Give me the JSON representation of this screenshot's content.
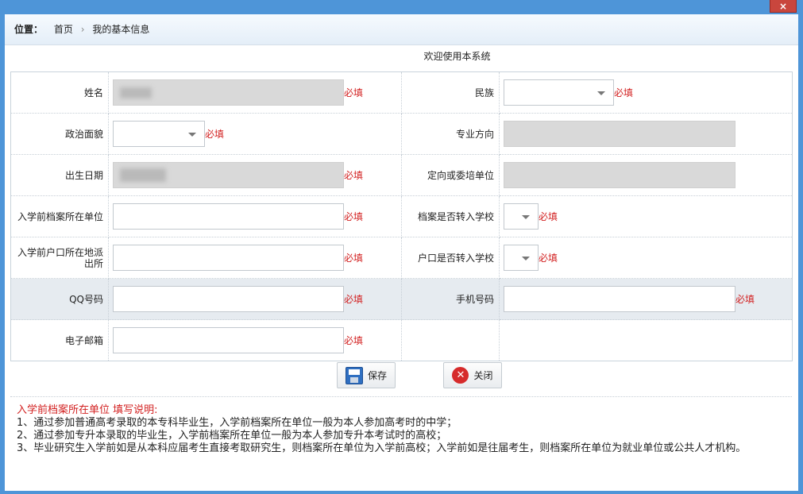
{
  "window": {
    "close_glyph": "×"
  },
  "location": {
    "label": "位置：",
    "crumbs": [
      "首页",
      "我的基本信息"
    ],
    "separator": "›"
  },
  "welcome": "欢迎使用本系统",
  "required_text": "必填",
  "form": {
    "name_label": "姓名",
    "ethnicity_label": "民族",
    "ethnicity_value": "",
    "political_label": "政治面貌",
    "political_value": "",
    "major_label": "专业方向",
    "major_value": "",
    "birth_label": "出生日期",
    "unit_label": "定向或委培单位",
    "unit_value": "",
    "archive_unit_label": "入学前档案所在单位",
    "archive_unit_value": "",
    "archive_transfer_label": "档案是否转入学校",
    "archive_transfer_value": "",
    "hukou_station_label": "入学前户口所在地派出所",
    "hukou_station_value": "",
    "hukou_transfer_label": "户口是否转入学校",
    "hukou_transfer_value": "",
    "qq_label": "QQ号码",
    "qq_value": "",
    "phone_label": "手机号码",
    "phone_value": "",
    "email_label": "电子邮箱",
    "email_value": ""
  },
  "buttons": {
    "save": "保存",
    "close": "关闭"
  },
  "icons": {
    "save": "floppy-disk-icon",
    "close": "close-circle-icon",
    "dropdown": "chevron-down-icon"
  },
  "notes": {
    "title": "入学前档案所在单位 填写说明:",
    "lines": [
      "1、通过参加普通高考录取的本专科毕业生，入学前档案所在单位一般为本人参加高考时的中学；",
      "2、通过参加专升本录取的毕业生，入学前档案所在单位一般为本人参加专升本考试时的高校；",
      "3、毕业研究生入学前如是从本科应届考生直接考取研究生，则档案所在单位为入学前高校；入学前如是往届考生，则档案所在单位为就业单位或公共人才机构。"
    ]
  },
  "colors": {
    "required": "#d21f1f",
    "frame": "#4e95d8",
    "readonly": "#d9d9d9",
    "highlight_row": "#e6ebf0"
  }
}
